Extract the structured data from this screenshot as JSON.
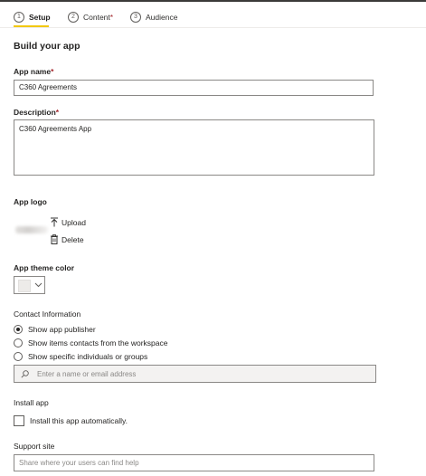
{
  "tabs": [
    {
      "number": "1",
      "label": "Setup",
      "required": ""
    },
    {
      "number": "2",
      "label": "Content",
      "required": "*"
    },
    {
      "number": "3",
      "label": "Audience",
      "required": ""
    }
  ],
  "heading": "Build your app",
  "app_name": {
    "label": "App name",
    "required": "*",
    "value": "C360 Agreements"
  },
  "description": {
    "label": "Description",
    "required": "*",
    "value": "C360 Agreements App"
  },
  "app_logo": {
    "label": "App logo",
    "upload_label": "Upload",
    "delete_label": "Delete"
  },
  "theme_color": {
    "label": "App theme color",
    "selected_color": "#edebe9"
  },
  "contact": {
    "label": "Contact Information",
    "options": [
      {
        "label": "Show app publisher",
        "checked": true
      },
      {
        "label": "Show items contacts from the workspace",
        "checked": false
      },
      {
        "label": "Show specific individuals or groups",
        "checked": false
      }
    ],
    "search_placeholder": "Enter a name or email address"
  },
  "install": {
    "label": "Install app",
    "checkbox_label": "Install this app automatically.",
    "checked": false
  },
  "support": {
    "label": "Support site",
    "placeholder": "Share where your users can find help"
  },
  "colors": {
    "accent": "#f2c811",
    "required": "#a4262c",
    "border": "#8a8886",
    "text": "#252423"
  },
  "icons": {
    "tab_numbers": "circled-number-icon",
    "upload": "upload-arrow-icon",
    "delete": "trash-icon",
    "dropdown": "chevron-down-icon",
    "search": "search-icon"
  }
}
